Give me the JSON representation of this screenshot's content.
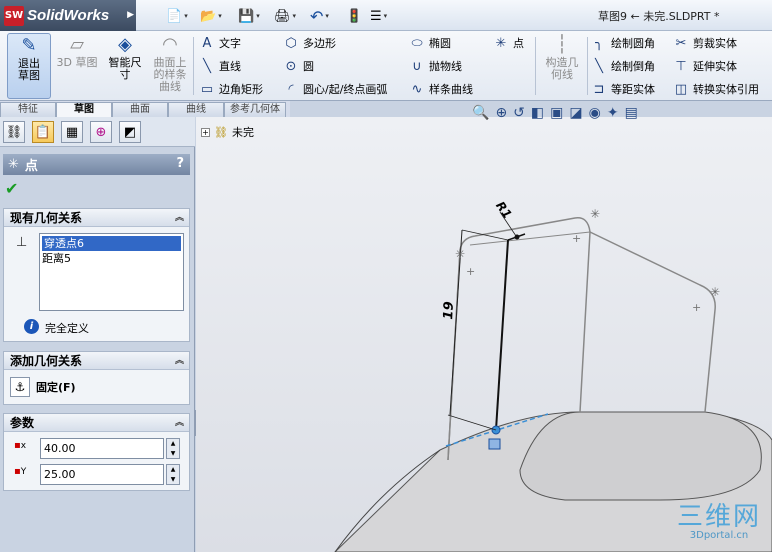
{
  "app": {
    "logo_text": "SolidWorks",
    "logo_badge": "SW",
    "document_title": "草图9 ← 未完.SLDPRT *"
  },
  "quick_access": [
    {
      "icon": "new-document-icon",
      "glyph": "📄"
    },
    {
      "icon": "open-folder-icon",
      "glyph": "📂"
    },
    {
      "icon": "save-icon",
      "glyph": "💾"
    },
    {
      "icon": "print-icon",
      "glyph": "🖨"
    },
    {
      "icon": "undo-icon",
      "glyph": "↶"
    },
    {
      "icon": "rebuild-traffic-light-icon",
      "glyph": "🚦"
    },
    {
      "icon": "options-icon",
      "glyph": "☰"
    }
  ],
  "ribbon": {
    "exit_sketch": "退出草图",
    "sketch_3d": "3D 草图",
    "smart_dimension": "智能尺寸",
    "sketch_on_surface": "曲面上的样条曲线",
    "text": "文字",
    "line": "直线",
    "corner_rect": "边角矩形",
    "polygon": "多边形",
    "circle": "圆",
    "arc": "圆心/起/终点画弧",
    "ellipse": "椭圆",
    "parabola": "抛物线",
    "spline": "样条曲线",
    "point": "点",
    "construction": "构造几何线",
    "fillet": "绘制圆角",
    "chamfer": "绘制倒角",
    "offset": "等距实体",
    "trim": "剪裁实体",
    "extend": "延伸实体",
    "convert": "转换实体引用"
  },
  "tabs": [
    "特征",
    "草图",
    "曲面",
    "曲线",
    "参考几何体"
  ],
  "active_tab": 1,
  "property_manager": {
    "title": "点",
    "help": "?",
    "existing_relations": {
      "header": "现有几何关系",
      "items": [
        "穿透点6",
        "距离5"
      ],
      "status": "完全定义"
    },
    "add_relations": {
      "header": "添加几何关系",
      "fix_label": "固定(F)"
    },
    "parameters": {
      "header": "参数",
      "x_label": "x",
      "x_value": "40.00",
      "y_label": "Y",
      "y_value": "25.00"
    }
  },
  "tree": {
    "root_label": "未完"
  },
  "sketch": {
    "dim_radius": "R1",
    "dim_length": "19"
  },
  "watermark": {
    "big": "三维网",
    "small": "3Dportal.cn"
  },
  "colors": {
    "accent": "#3168c6",
    "ok": "#199c24",
    "logo_red": "#c8202a",
    "highlight": "#3a8fd6"
  }
}
